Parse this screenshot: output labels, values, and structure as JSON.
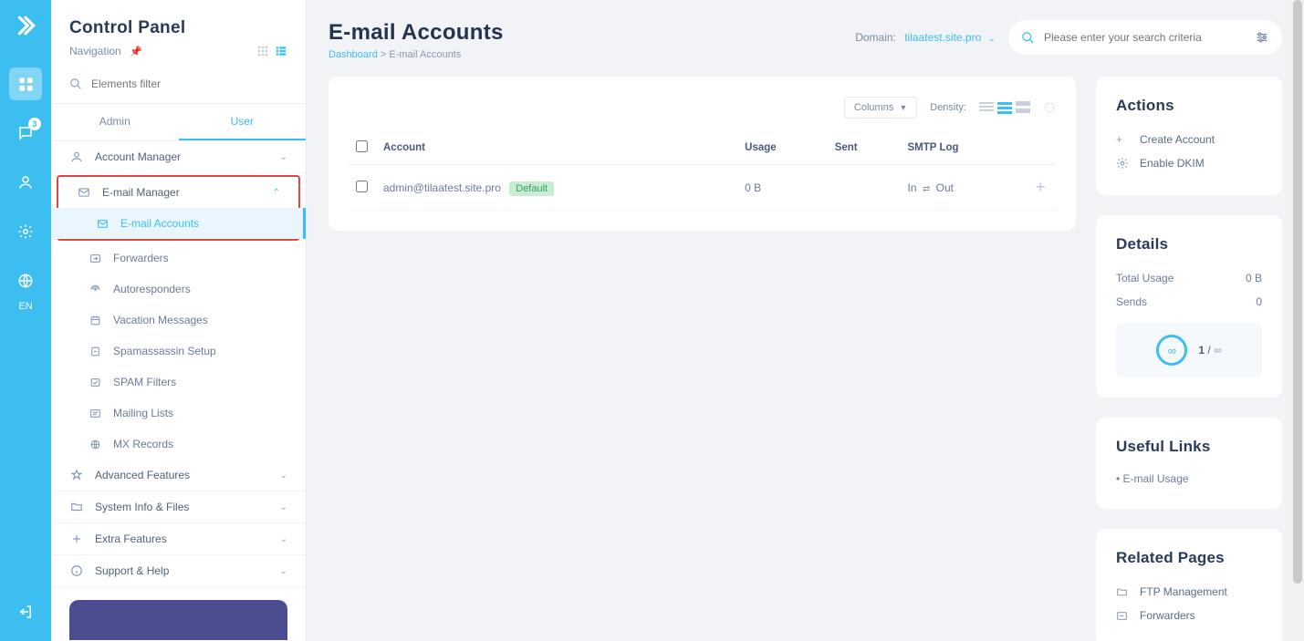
{
  "rail": {
    "badge": "3",
    "lang": "EN"
  },
  "sidebar": {
    "title": "Control Panel",
    "subtitle": "Navigation",
    "filter_placeholder": "Elements filter",
    "tabs": {
      "admin": "Admin",
      "user": "User"
    },
    "groups": {
      "account": "Account Manager",
      "email": "E-mail Manager",
      "advanced": "Advanced Features",
      "sysinfo": "System Info & Files",
      "extra": "Extra Features",
      "support": "Support & Help"
    },
    "email_items": {
      "accounts": "E-mail Accounts",
      "forwarders": "Forwarders",
      "autoresponders": "Autoresponders",
      "vacation": "Vacation Messages",
      "spamassassin": "Spamassassin Setup",
      "spamfilters": "SPAM Filters",
      "mailing": "Mailing Lists",
      "mx": "MX Records"
    }
  },
  "header": {
    "title": "E-mail Accounts",
    "crumb_dash": "Dashboard",
    "crumb_sep": " > ",
    "crumb_page": "E-mail Accounts",
    "domain_label": "Domain:",
    "domain_value": "tilaatest.site.pro",
    "search_placeholder": "Please enter your search criteria"
  },
  "table": {
    "columns_btn": "Columns",
    "density_label": "Density:",
    "headers": {
      "account": "Account",
      "usage": "Usage",
      "sent": "Sent",
      "smtp": "SMTP Log"
    },
    "row": {
      "email": "admin@tilaatest.site.pro",
      "default_badge": "Default",
      "usage": "0 B",
      "sent": "",
      "smtp_in": "In",
      "smtp_out": "Out"
    }
  },
  "actions": {
    "title": "Actions",
    "create": "Create Account",
    "dkim": "Enable DKIM"
  },
  "details": {
    "title": "Details",
    "total_label": "Total Usage",
    "total_value": "0 B",
    "sends_label": "Sends",
    "sends_value": "0",
    "quota_used": "1",
    "quota_sep": " / ",
    "quota_total": "∞",
    "infinity": "∞"
  },
  "useful": {
    "title": "Useful Links",
    "email_usage": "E-mail Usage"
  },
  "related": {
    "title": "Related Pages",
    "ftp": "FTP Management",
    "forwarders": "Forwarders"
  }
}
